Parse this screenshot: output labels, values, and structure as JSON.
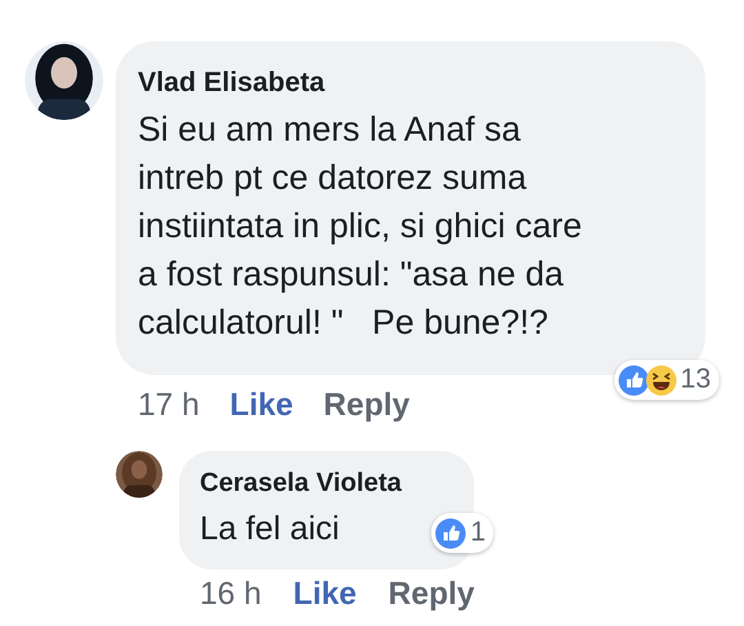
{
  "comments": [
    {
      "author": "Vlad Elisabeta",
      "lines": [
        "Si eu am mers la Anaf sa",
        "intreb pt ce datorez suma",
        "instiintata in plic, si ghici care",
        "a fost raspunsul: \"asa ne da",
        "calculatorul! \"   Pe bune?!?"
      ],
      "reactions": {
        "types": [
          {
            "kind": "like"
          },
          {
            "kind": "haha"
          }
        ],
        "count": "13"
      },
      "time": "17 h",
      "like": "Like",
      "reply": "Reply",
      "replies": [
        {
          "author": "Cerasela Violeta",
          "lines": [
            "La fel aici"
          ],
          "reactions": {
            "types": [
              {
                "kind": "like"
              }
            ],
            "count": "1"
          },
          "time": "16 h",
          "like": "Like",
          "reply": "Reply"
        }
      ]
    }
  ]
}
